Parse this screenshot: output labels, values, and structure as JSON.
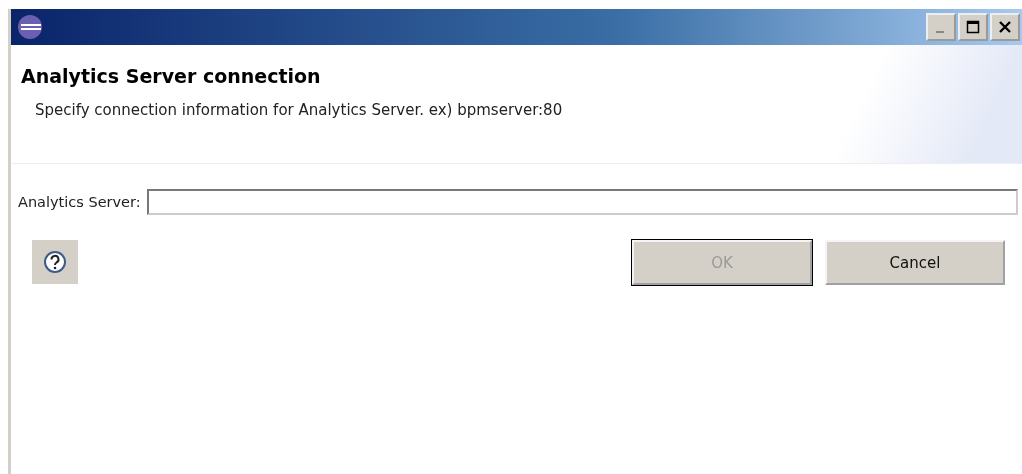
{
  "header": {
    "title": "Analytics Server connection",
    "description": "Specify connection information for Analytics Server. ex) bpmserver:80"
  },
  "field": {
    "label": "Analytics Server:"
  },
  "buttons": [
    {
      "label": "OK",
      "disabled": true,
      "default": true
    },
    {
      "label": "Cancel",
      "disabled": false,
      "default": false
    }
  ]
}
